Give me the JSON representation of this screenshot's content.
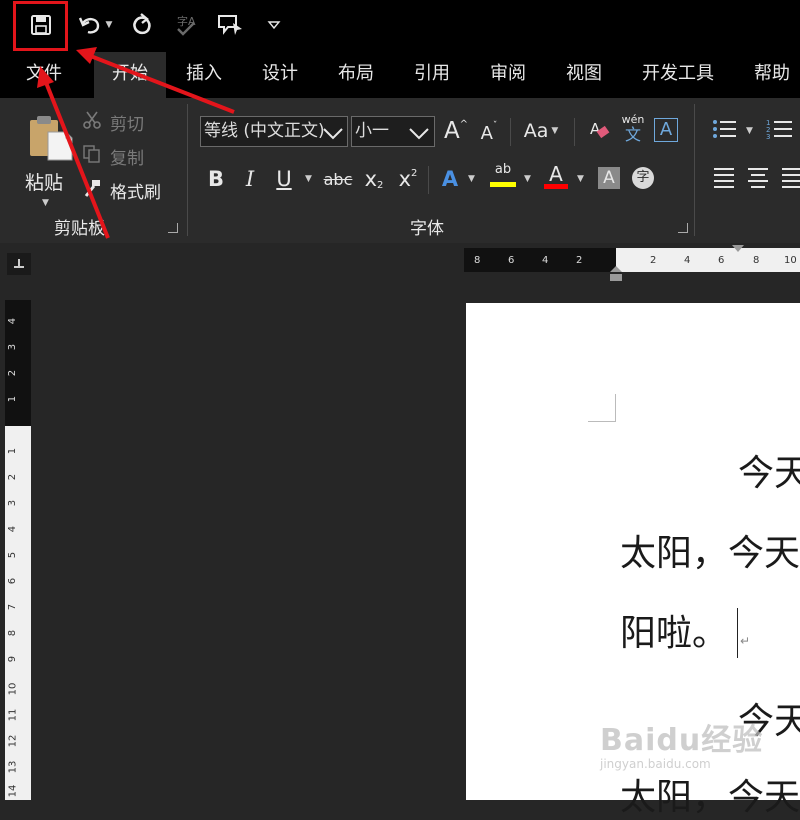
{
  "quick_access": {
    "save_icon": "save-icon",
    "undo_icon": "undo-icon",
    "redo_icon": "redo-icon",
    "spelling_icon": "spelling-icon",
    "touch_mode_icon": "touch-mode-icon",
    "customize_icon": "chevron-down-icon"
  },
  "tabs": [
    "文件",
    "开始",
    "插入",
    "设计",
    "布局",
    "引用",
    "审阅",
    "视图",
    "开发工具",
    "帮助"
  ],
  "ribbon": {
    "clipboard": {
      "paste_label": "粘贴",
      "cut_label": "剪切",
      "copy_label": "复制",
      "format_painter_label": "格式刷",
      "group_label": "剪贴板"
    },
    "font": {
      "font_name": "等线 (中文正文)",
      "font_size": "小一",
      "grow_font": "A",
      "shrink_font": "A",
      "change_case": "Aa",
      "phonetic_top": "wén",
      "phonetic_bottom": "文",
      "char_border": "A",
      "bold": "B",
      "italic": "I",
      "underline": "U",
      "strikethrough": "abc",
      "subscript": "x",
      "subscript_mark": "2",
      "superscript": "x",
      "superscript_mark": "2",
      "text_effects": "A",
      "highlight": "ab",
      "font_color": "A",
      "char_shading": "A",
      "enclose_char": "字",
      "group_label": "字体"
    },
    "paragraph": {
      "bullets_icon": "bullets-icon",
      "numbering_icon": "numbering-icon",
      "align_left_icon": "align-left-icon",
      "align_center_icon": "align-center-icon",
      "align_right_icon": "align-right-icon"
    }
  },
  "ruler": {
    "corner_icon": "tab-stop-icon",
    "horizontal_left_numbers": [
      "8",
      "6",
      "4",
      "2"
    ],
    "horizontal_right_numbers": [
      "2",
      "4",
      "6",
      "8",
      "10"
    ],
    "vertical_top_numbers": [
      "4",
      "3",
      "2",
      "1"
    ],
    "vertical_numbers": [
      "1",
      "1",
      "2",
      "3",
      "4",
      "5",
      "6",
      "7",
      "8",
      "9",
      "10",
      "11",
      "12",
      "13",
      "14"
    ]
  },
  "document": {
    "line1": "今天",
    "line2": "太阳，今天",
    "line3": "阳啦。",
    "paragraph_mark": "↵",
    "line4": "今天",
    "line5": "太阳，今天"
  },
  "watermark": {
    "logo": "Baidu经验",
    "url": "jingyan.baidu.com"
  },
  "colors": {
    "annotation_red": "#e3151b",
    "highlight_yellow": "#ffff00",
    "font_color_red": "#ff0000",
    "text_effects_blue": "#4a90e2",
    "background": "#262626"
  }
}
